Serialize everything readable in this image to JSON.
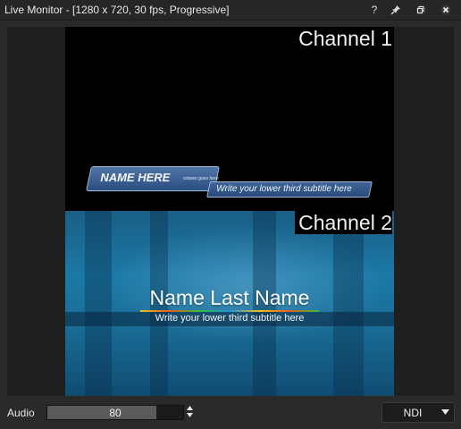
{
  "window": {
    "title": "Live Monitor - [1280 x 720, 30 fps, Progressive]",
    "buttons": [
      {
        "name": "help",
        "label": "?"
      },
      {
        "name": "pin",
        "icon": "pin-icon"
      },
      {
        "name": "restore",
        "icon": "restore-icon"
      },
      {
        "name": "close",
        "icon": "close-icon"
      }
    ]
  },
  "preview": {
    "channel1": {
      "label": "Channel 1",
      "lower_third": {
        "name": "NAME HERE",
        "small_text": "sixteen goes here",
        "subtitle": "Write your lower third subtitle here"
      }
    },
    "channel2": {
      "label": "Channel 2",
      "lower_third": {
        "name": "Name Last Name",
        "subtitle": "Write your lower third subtitle here"
      }
    }
  },
  "audio": {
    "label": "Audio",
    "value": "80",
    "level_fraction": 0.8
  },
  "output": {
    "selected": "NDI"
  },
  "colors": {
    "window_bg": "#2a2a2a",
    "lower_third_blue": "#2b4e82",
    "channel2_bg": "#1b79a6"
  }
}
